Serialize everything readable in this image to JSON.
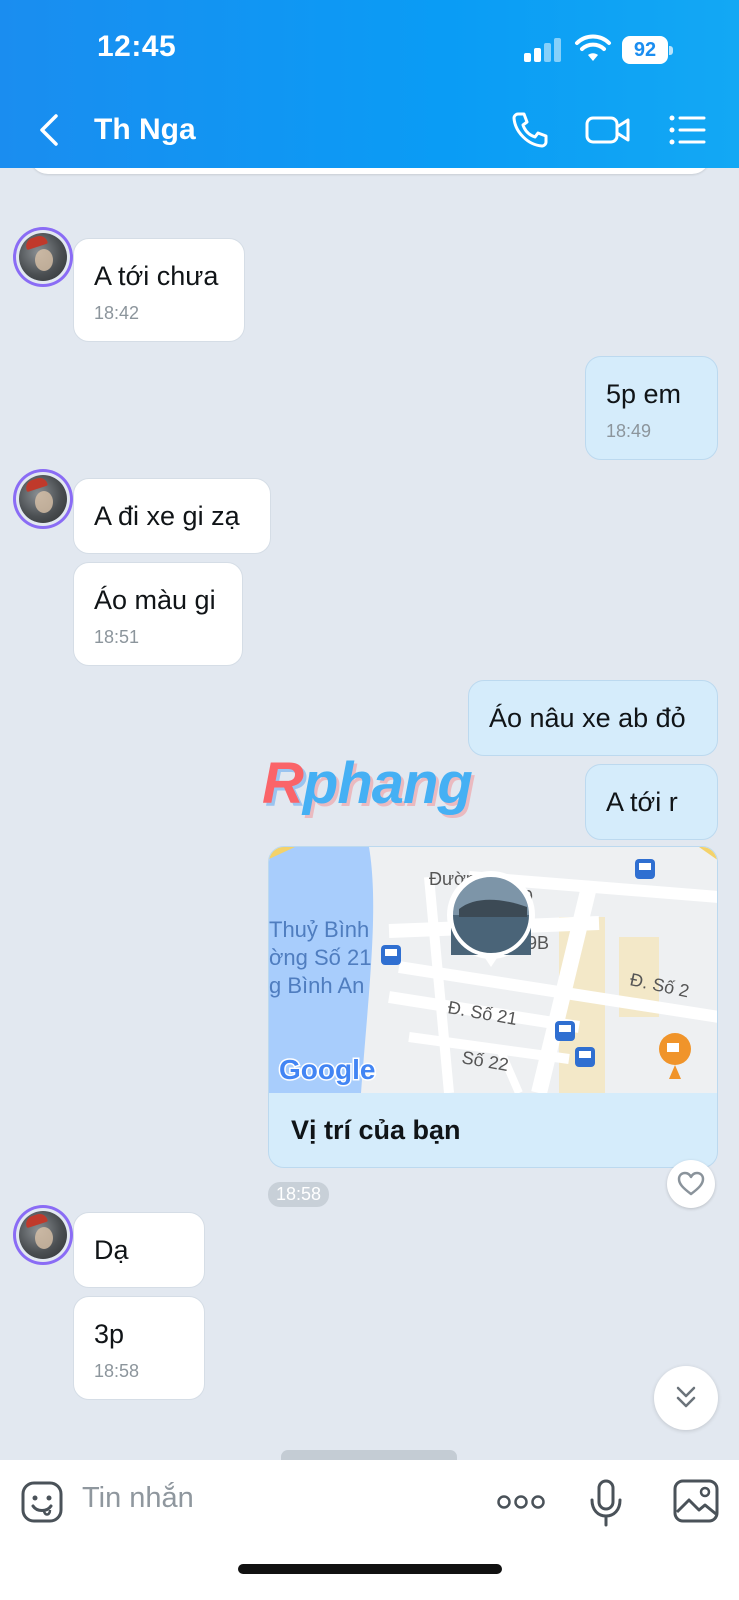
{
  "status_bar": {
    "time": "12:45",
    "battery": "92"
  },
  "header": {
    "contact_name": "Th Nga"
  },
  "messages": [
    {
      "dir": "in",
      "text": "A tới chưa",
      "time": "18:42"
    },
    {
      "dir": "out",
      "text": "5p em",
      "time": "18:49"
    },
    {
      "dir": "in",
      "text": "A đi xe gi zạ",
      "time": ""
    },
    {
      "dir": "in",
      "text": "Áo màu gi",
      "time": "18:51"
    },
    {
      "dir": "out",
      "text": "Áo nâu xe ab đỏ",
      "time": ""
    },
    {
      "dir": "out",
      "text": "A tới r",
      "time": ""
    },
    {
      "dir": "in",
      "text": "Dạ",
      "time": ""
    },
    {
      "dir": "in",
      "text": "3p",
      "time": "18:58"
    }
  ],
  "location_card": {
    "label": "Vị trí của bạn",
    "time": "18:58",
    "map_labels": {
      "street_top": "Đường",
      "street_top_num": "9",
      "label_9b": "9B",
      "ward": "Thuỷ Bình",
      "school_line": "ờng Số 21",
      "area": "g Bình An",
      "so2": "Đ. Số 2",
      "so21": "Đ. Số 21",
      "so22": "Số 22",
      "logo": "Google"
    }
  },
  "watermark": {
    "part1": "R",
    "part2": "phang"
  },
  "input": {
    "placeholder": "Tin nhắn"
  },
  "colors": {
    "header": "#1a8df0",
    "incoming": "#ffffff",
    "outgoing": "#d5ecfb",
    "background": "#e2e8f0"
  }
}
